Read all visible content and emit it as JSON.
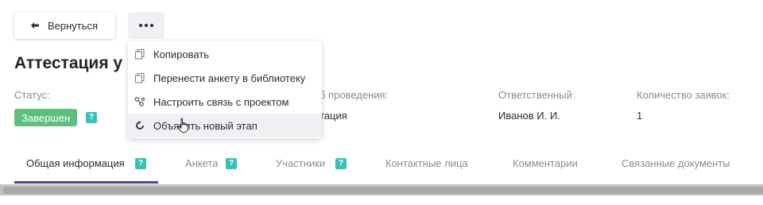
{
  "header": {
    "back_label": "Вернуться",
    "title": "Аттестация у"
  },
  "menu": {
    "items": [
      {
        "label": "Копировать",
        "icon": "copy-icon"
      },
      {
        "label": "Перенести анкету в библиотеку",
        "icon": "copy-icon"
      },
      {
        "label": "Настроить связь с проектом",
        "icon": "link-icon"
      },
      {
        "label": "Объявить новый этап",
        "icon": "refresh-icon"
      }
    ],
    "hovered_index": 3
  },
  "meta": {
    "status_label": "Статус:",
    "status_value": "Завершен",
    "help_mark": "?",
    "conduct_label": "б проведения:",
    "conduct_value": "тация",
    "responsible_label": "Ответственный:",
    "responsible_value": "Иванов И. И.",
    "requests_label": "Количество заявок:",
    "requests_value": "1"
  },
  "tabs": [
    {
      "label": "Общая информация",
      "help": true,
      "active": true
    },
    {
      "label": "Анкета",
      "help": true,
      "active": false
    },
    {
      "label": "Участники",
      "help": true,
      "active": false
    },
    {
      "label": "Контактные лица",
      "help": false,
      "active": false
    },
    {
      "label": "Комментарии",
      "help": false,
      "active": false
    },
    {
      "label": "Связанные документы",
      "help": false,
      "active": false
    }
  ],
  "colors": {
    "status_green": "#5cbf7e",
    "help_teal": "#38c1b6",
    "tab_accent": "#5b3f8f",
    "menu_hover": "#eef0f3"
  }
}
